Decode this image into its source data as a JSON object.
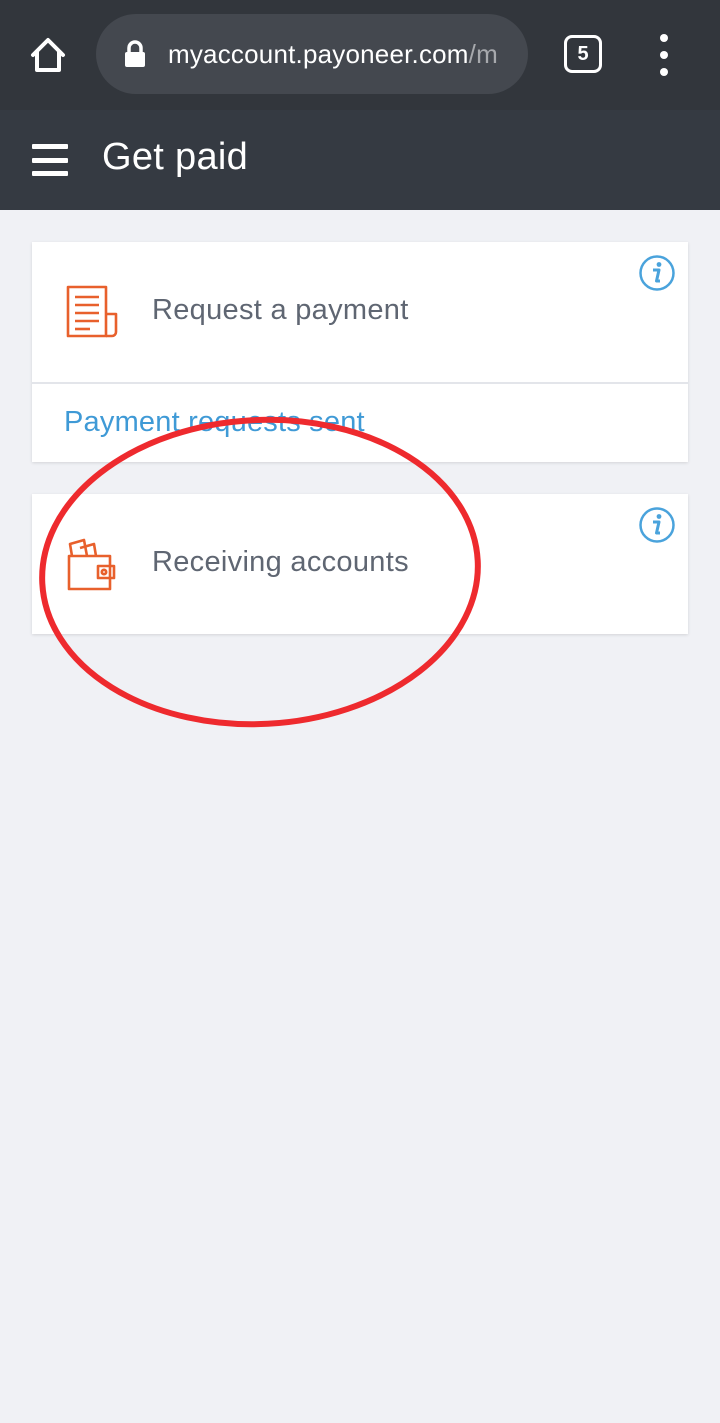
{
  "browser": {
    "url_main": "myaccount.payoneer.com",
    "url_rest": "/m",
    "tab_count": "5"
  },
  "header": {
    "title": "Get paid"
  },
  "cards": [
    {
      "label": "Request a payment",
      "icon": "document-icon",
      "link": "Payment requests sent"
    },
    {
      "label": "Receiving accounts",
      "icon": "wallet-icon"
    }
  ],
  "colors": {
    "browser_bar": "#32363c",
    "app_header": "#353a42",
    "accent_orange": "#e8602c",
    "link_blue": "#3f9ad6",
    "info_blue": "#4aa3dc",
    "annotation_red": "#ee2a2e",
    "background": "#f0f1f5"
  }
}
